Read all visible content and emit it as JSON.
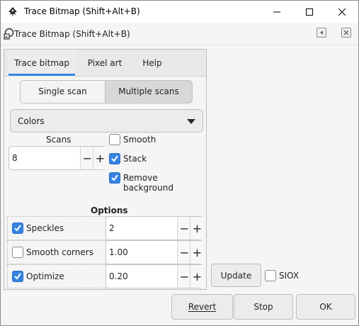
{
  "window": {
    "title": "Trace Bitmap (Shift+Alt+B)",
    "icon": "inkscape-icon"
  },
  "dock": {
    "title": "Trace Bitmap (Shift+Alt+B)"
  },
  "tabs": [
    {
      "label": "Trace bitmap",
      "active": true
    },
    {
      "label": "Pixel art",
      "active": false
    },
    {
      "label": "Help",
      "active": false
    }
  ],
  "scan_mode": {
    "single": "Single scan",
    "multiple": "Multiple scans",
    "selected": "Multiple scans"
  },
  "mode_select": {
    "value": "Colors"
  },
  "scans": {
    "label": "Scans",
    "value": "8"
  },
  "checks": {
    "smooth": {
      "label": "Smooth",
      "checked": false
    },
    "stack": {
      "label": "Stack",
      "checked": true
    },
    "remove_bg": {
      "label": "Remove background",
      "checked": true
    }
  },
  "options": {
    "heading": "Options",
    "speckles": {
      "label": "Speckles",
      "checked": true,
      "value": "2"
    },
    "smooth_corners": {
      "label": "Smooth corners",
      "checked": false,
      "value": "1.00"
    },
    "optimize": {
      "label": "Optimize",
      "checked": true,
      "value": "0.20"
    }
  },
  "preview": {
    "update": "Update",
    "siox": {
      "label": "SIOX",
      "checked": false
    }
  },
  "footer": {
    "revert": "Revert",
    "stop": "Stop",
    "ok": "OK"
  },
  "colors": {
    "accent": "#3584e4"
  }
}
